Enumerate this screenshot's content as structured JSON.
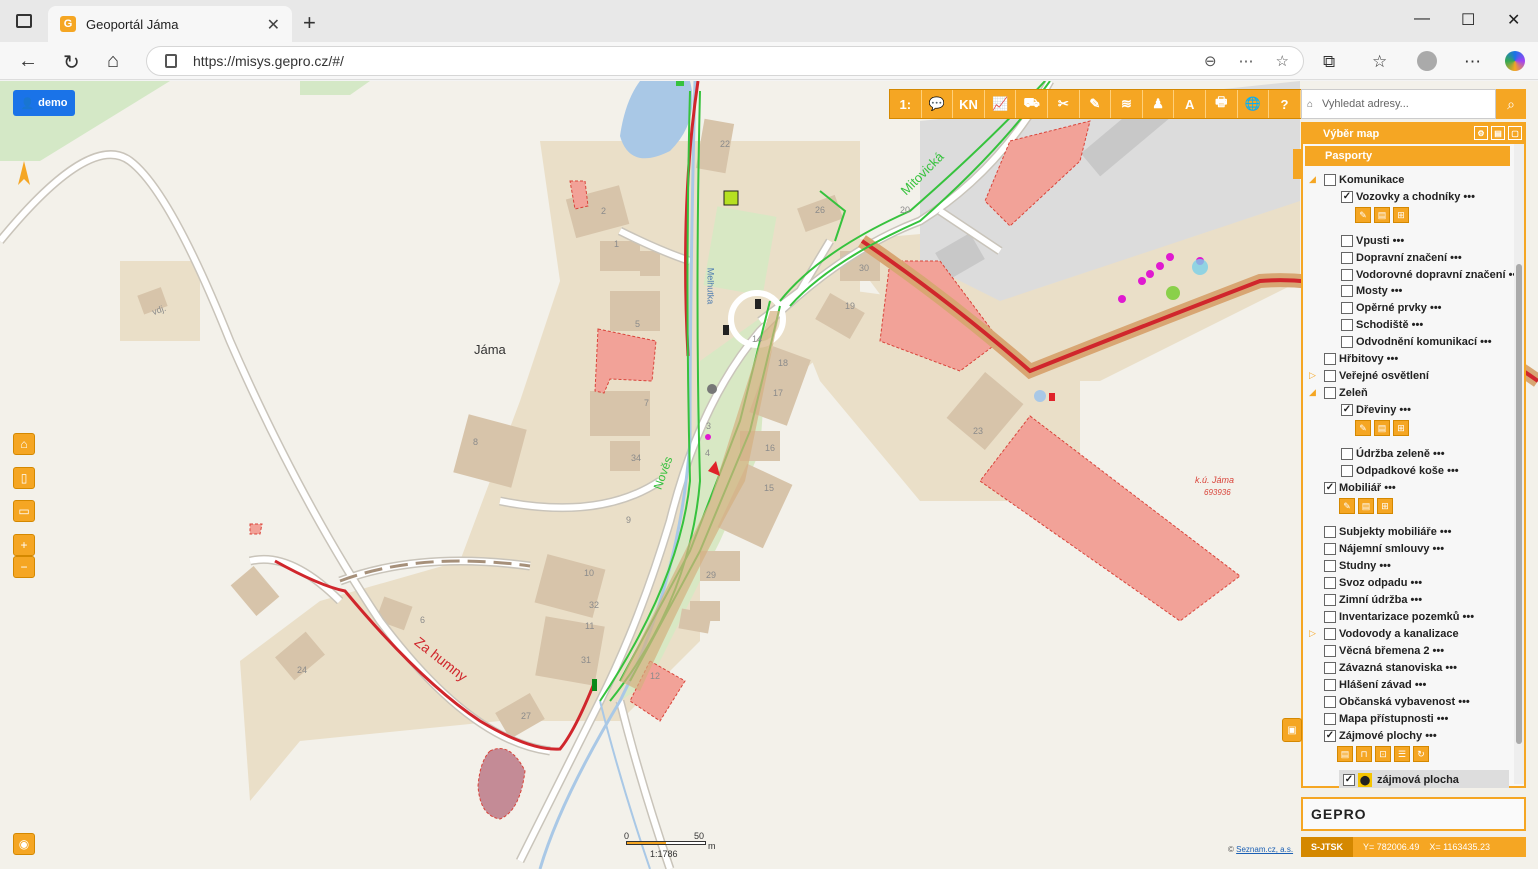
{
  "browser": {
    "tab_title": "Geoportál Jáma",
    "url": "https://misys.gepro.cz/#/"
  },
  "map": {
    "user_button": "demo",
    "search_placeholder": "Vyhledat adresy...",
    "toolbar": [
      "1:",
      "💬",
      "KN",
      "📈",
      "⛟",
      "✂",
      "✎",
      "≋",
      "♟",
      "A",
      "🖶",
      "🌐",
      "?"
    ],
    "labels": {
      "village": "Jáma",
      "street_za_humny": "Za humny",
      "street_mitovicka": "Mitovická",
      "street_novesa": "Nověs",
      "river": "Melhutka",
      "cadastre": "k.ú. Jáma",
      "cadastre_code": "693936",
      "vdj": "vdj."
    },
    "house_numbers": [
      "22",
      "2",
      "1",
      "5",
      "7",
      "8",
      "34",
      "9",
      "10",
      "32",
      "11",
      "31",
      "27",
      "24",
      "6",
      "19",
      "30",
      "20",
      "26",
      "17",
      "16",
      "15",
      "18",
      "29",
      "12",
      "23",
      "14",
      "3",
      "4"
    ],
    "scale": {
      "left": "0",
      "right": "50",
      "unit": "m",
      "ratio": "1:1786"
    },
    "copyright_prefix": "©",
    "copyright_link": "Seznam.cz, a.s.",
    "logo": "GEPRO",
    "coords": {
      "system": "S-JTSK",
      "y": "Y= 782006.49",
      "x": "X= 1163435.23"
    }
  },
  "panel": {
    "title": "Výběr map",
    "section": "Pasporty",
    "rows": [
      {
        "label": "Komunikace",
        "checked": false,
        "indent": 0
      },
      {
        "label": "Vozovky a chodníky •••",
        "checked": true,
        "indent": 1
      },
      {
        "label": "Vpusti •••",
        "checked": false,
        "indent": 1
      },
      {
        "label": "Dopravní značení •••",
        "checked": false,
        "indent": 1
      },
      {
        "label": "Vodorovné dopravní značení •••",
        "checked": false,
        "indent": 1
      },
      {
        "label": "Mosty •••",
        "checked": false,
        "indent": 1
      },
      {
        "label": "Opěrné prvky •••",
        "checked": false,
        "indent": 1
      },
      {
        "label": "Schodiště •••",
        "checked": false,
        "indent": 1
      },
      {
        "label": "Odvodnění komunikací •••",
        "checked": false,
        "indent": 1
      },
      {
        "label": "Hřbitovy •••",
        "checked": false,
        "indent": 0
      },
      {
        "label": "Veřejné osvětlení",
        "checked": false,
        "indent": 0
      },
      {
        "label": "Zeleň",
        "checked": false,
        "indent": 0
      },
      {
        "label": "Dřeviny •••",
        "checked": true,
        "indent": 1
      },
      {
        "label": "Údržba zeleně •••",
        "checked": false,
        "indent": 1
      },
      {
        "label": "Odpadkové koše •••",
        "checked": false,
        "indent": 1
      },
      {
        "label": "Mobiliář •••",
        "checked": true,
        "indent": 0
      },
      {
        "label": "Subjekty mobiliáře •••",
        "checked": false,
        "indent": 0
      },
      {
        "label": "Nájemní smlouvy •••",
        "checked": false,
        "indent": 0
      },
      {
        "label": "Studny •••",
        "checked": false,
        "indent": 0
      },
      {
        "label": "Svoz odpadu •••",
        "checked": false,
        "indent": 0
      },
      {
        "label": "Zimní údržba •••",
        "checked": false,
        "indent": 0
      },
      {
        "label": "Inventarizace pozemků •••",
        "checked": false,
        "indent": 0
      },
      {
        "label": "Vodovody a kanalizace",
        "checked": false,
        "indent": 0
      },
      {
        "label": "Věcná břemena 2 •••",
        "checked": false,
        "indent": 0
      },
      {
        "label": "Závazná stanoviska •••",
        "checked": false,
        "indent": 0
      },
      {
        "label": "Hlášení závad •••",
        "checked": false,
        "indent": 0
      },
      {
        "label": "Občanská vybavenost •••",
        "checked": false,
        "indent": 0
      },
      {
        "label": "Mapa přístupnosti •••",
        "checked": false,
        "indent": 0
      },
      {
        "label": "Zájmové plochy •••",
        "checked": true,
        "indent": 0
      }
    ],
    "legend_item": "zájmová plocha"
  }
}
